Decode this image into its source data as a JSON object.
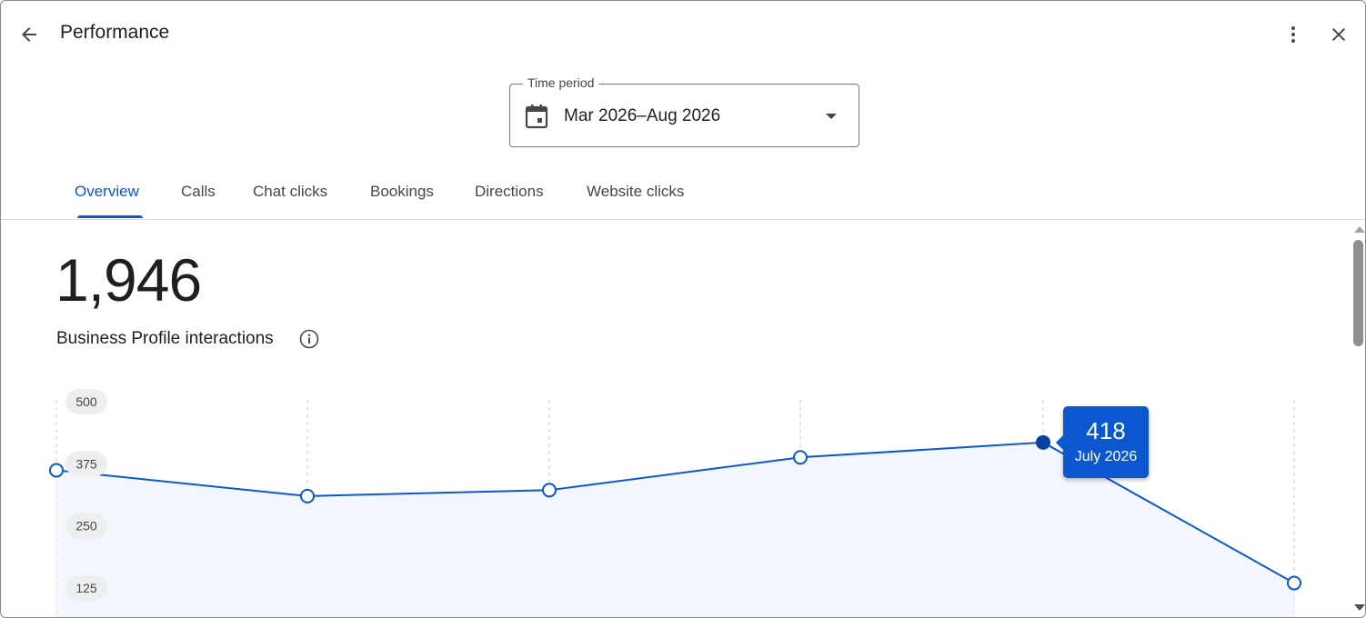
{
  "header": {
    "title": "Performance",
    "back_icon": "arrow-back-icon",
    "more_icon": "more-vert-icon",
    "close_icon": "close-icon"
  },
  "time_period": {
    "label": "Time period",
    "value": "Mar 2026–Aug 2026",
    "icon": "calendar-icon"
  },
  "tabs": [
    {
      "label": "Overview",
      "active": true
    },
    {
      "label": "Calls",
      "active": false
    },
    {
      "label": "Chat clicks",
      "active": false
    },
    {
      "label": "Bookings",
      "active": false
    },
    {
      "label": "Directions",
      "active": false
    },
    {
      "label": "Website clicks",
      "active": false
    }
  ],
  "summary": {
    "total": "1,946",
    "label": "Business Profile interactions",
    "info_icon": "info-icon"
  },
  "colors": {
    "accent": "#0b57d0",
    "line": "#0b57d0",
    "area": "#f3f6fd",
    "grid": "#c4c7c5"
  },
  "chart_data": {
    "type": "area",
    "y_ticks": [
      "500",
      "375",
      "250",
      "125"
    ],
    "ylim": [
      0,
      500
    ],
    "series": [
      {
        "values": [
          362,
          310,
          322,
          388,
          418,
          135
        ]
      }
    ],
    "highlight": {
      "index": 4,
      "value": "418",
      "label": "July 2026"
    }
  }
}
